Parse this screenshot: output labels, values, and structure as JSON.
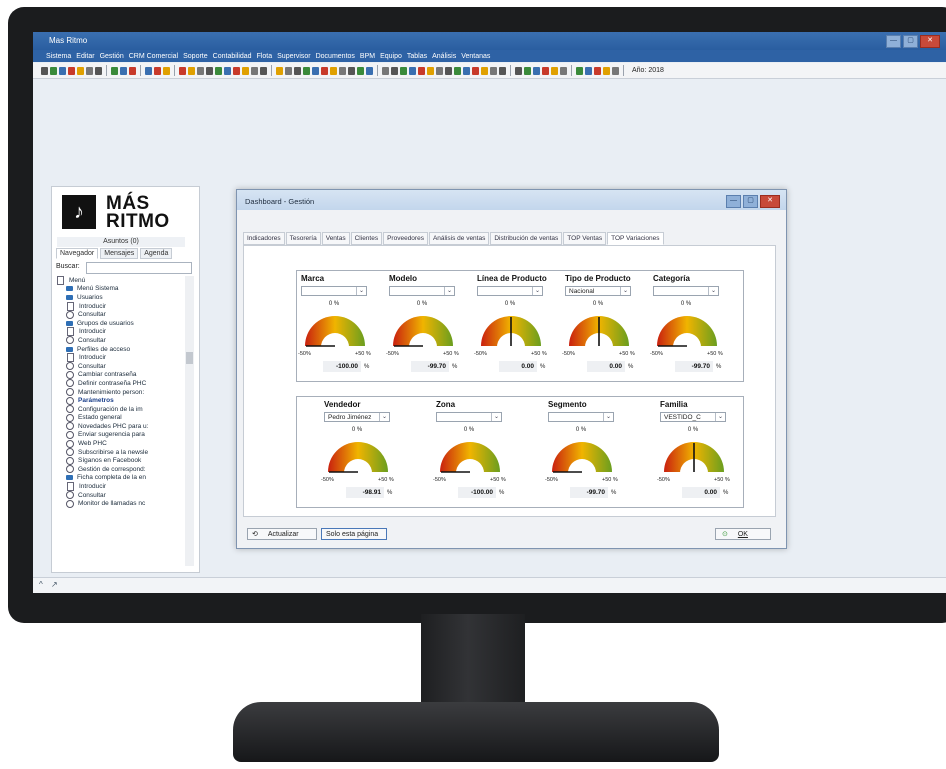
{
  "app": {
    "title": "Mas Ritmo",
    "window_buttons": [
      "—",
      "▢",
      "✕"
    ],
    "menu": [
      "Sistema",
      "Editar",
      "Gestión",
      "CRM Comercial",
      "Soporte",
      "Contabilidad",
      "Flota",
      "Supervisor",
      "Documentos",
      "BPM",
      "Equipo",
      "Tablas",
      "Análisis",
      "Ventanas"
    ],
    "year_label": "Año: 2018",
    "status_icons": [
      "^",
      "↗"
    ]
  },
  "left_panel": {
    "logo": {
      "line1": "MÁS",
      "line2": "RITMO",
      "symbol": "♪"
    },
    "asuntos": "Asuntos (0)",
    "tabs": [
      "Navegador",
      "Mensajes",
      "Agenda"
    ],
    "search_label": "Buscar:",
    "search_value": "",
    "tree": [
      {
        "icon": "expander",
        "label": "Menú"
      },
      {
        "icon": "folder",
        "label": "Menú Sistema"
      },
      {
        "icon": "folder",
        "label": "Usuarios"
      },
      {
        "icon": "doc",
        "label": "Introducir"
      },
      {
        "icon": "circle",
        "label": "Consultar"
      },
      {
        "icon": "folder",
        "label": "Grupos de usuarios"
      },
      {
        "icon": "doc",
        "label": "Introducir"
      },
      {
        "icon": "circle",
        "label": "Consultar"
      },
      {
        "icon": "folder",
        "label": "Perfiles de acceso"
      },
      {
        "icon": "doc",
        "label": "Introducir"
      },
      {
        "icon": "circle",
        "label": "Consultar"
      },
      {
        "icon": "circle",
        "label": "Cambiar contraseña"
      },
      {
        "icon": "circle",
        "label": "Definir contraseña PHC"
      },
      {
        "icon": "circle",
        "label": "Mantenimiento person:"
      },
      {
        "icon": "circle",
        "label": "Parámetros"
      },
      {
        "icon": "circle",
        "label": "Configuración de la im"
      },
      {
        "icon": "circle",
        "label": "Estado general"
      },
      {
        "icon": "circle",
        "label": "Novedades PHC para u:"
      },
      {
        "icon": "circle",
        "label": "Enviar sugerencia para"
      },
      {
        "icon": "circle",
        "label": "Web PHC"
      },
      {
        "icon": "circle",
        "label": "Subscribirse a la newsle"
      },
      {
        "icon": "circle",
        "label": "Síganos en Facebook"
      },
      {
        "icon": "circle",
        "label": "Gestión de correspond:"
      },
      {
        "icon": "folder",
        "label": "Ficha completa de la en"
      },
      {
        "icon": "doc",
        "label": "Introducir"
      },
      {
        "icon": "circle",
        "label": "Consultar"
      },
      {
        "icon": "circle",
        "label": "Monitor de llamadas nc"
      }
    ]
  },
  "dashboard": {
    "title": "Dashboard - Gestión",
    "tabs": [
      "Indicadores",
      "Tesorería",
      "Ventas",
      "Clientes",
      "Proveedores",
      "Análisis de ventas",
      "Distribución de ventas",
      "TOP Ventas",
      "TOP Variaciones"
    ],
    "active_tab": 8,
    "row1": [
      {
        "label": "Marca",
        "select": "",
        "zero": "0 %",
        "min": "-50%",
        "max": "+50 %",
        "value": "-100.00",
        "unit": "%",
        "needle": -100.0
      },
      {
        "label": "Modelo",
        "select": "",
        "zero": "0 %",
        "min": "-50%",
        "max": "+50 %",
        "value": "-99.70",
        "unit": "%",
        "needle": -99.7
      },
      {
        "label": "Línea de Producto",
        "select": "",
        "zero": "0 %",
        "min": "-50%",
        "max": "+50 %",
        "value": "0.00",
        "unit": "%",
        "needle": 0.0
      },
      {
        "label": "Tipo de Producto",
        "select": "Nacional",
        "zero": "0 %",
        "min": "-50%",
        "max": "+50 %",
        "value": "0.00",
        "unit": "%",
        "needle": 0.0
      },
      {
        "label": "Categoría",
        "select": "",
        "zero": "0 %",
        "min": "-50%",
        "max": "+50 %",
        "value": "-99.70",
        "unit": "%",
        "needle": -99.7
      }
    ],
    "row2": [
      {
        "label": "Vendedor",
        "select": "Pedro Jiménez",
        "zero": "0 %",
        "min": "-50%",
        "max": "+50 %",
        "value": "-98.91",
        "unit": "%",
        "needle": -98.91
      },
      {
        "label": "Zona",
        "select": "",
        "zero": "0 %",
        "min": "-50%",
        "max": "+50 %",
        "value": "-100.00",
        "unit": "%",
        "needle": -100.0
      },
      {
        "label": "Segmento",
        "select": "",
        "zero": "0 %",
        "min": "-50%",
        "max": "+50 %",
        "value": "-99.70",
        "unit": "%",
        "needle": -99.7
      },
      {
        "label": "Familia",
        "select": "VESTIDO_C",
        "zero": "0 %",
        "min": "-50%",
        "max": "+50 %",
        "value": "0.00",
        "unit": "%",
        "needle": 0.0
      }
    ],
    "buttons": {
      "refresh": "Actualizar",
      "only_page": "Solo esta página",
      "ok": "OK"
    },
    "gauge_colors": [
      "#c9200f",
      "#f0b400",
      "#6a9e1f"
    ]
  }
}
